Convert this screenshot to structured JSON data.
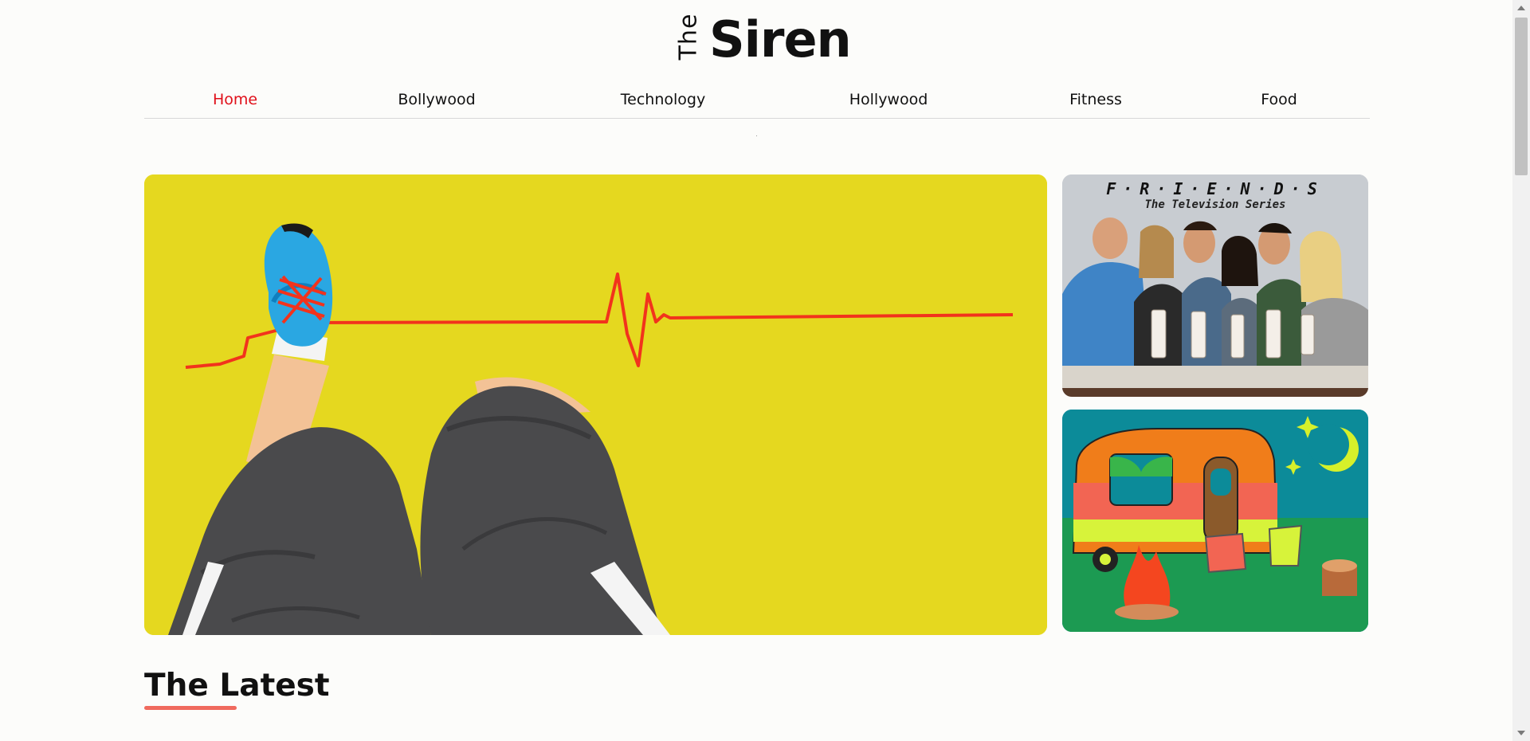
{
  "logo": {
    "the": "The",
    "siren": "Siren"
  },
  "nav": {
    "items": [
      "Home",
      "Bollywood",
      "Technology",
      "Hollywood",
      "Fitness",
      "Food"
    ],
    "active": "Home",
    "active_color": "#e0101a"
  },
  "cards": {
    "hero": {
      "image": "running-legs-heartbeat-illustration",
      "bg": "#e5d81f"
    },
    "friends": {
      "title": "F·R·I·E·N·D·S",
      "subtitle": "The Television Series",
      "image": "friends-cast-milkshakes-photo"
    },
    "camp": {
      "image": "camper-van-campfire-illustration"
    }
  },
  "section": {
    "title": "The Latest",
    "underline_color": "#f06a5e"
  },
  "icons": {
    "scroll_up": "chevron-up-icon",
    "scroll_down": "chevron-down-icon"
  }
}
